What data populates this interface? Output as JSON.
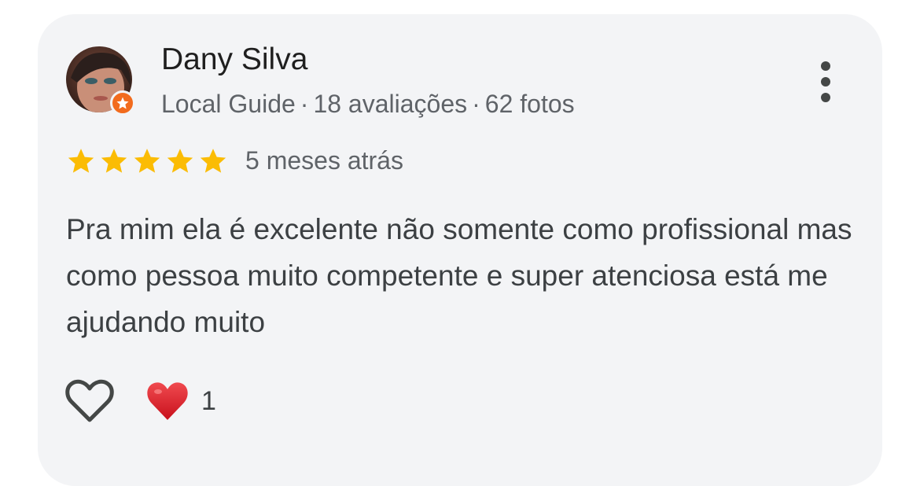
{
  "review": {
    "author_name": "Dany Silva",
    "author_level": "Local Guide",
    "separator": "·",
    "review_count": "18 avaliações",
    "photo_count": "62 fotos",
    "rating": 5,
    "date": "5 meses atrás",
    "text": "Pra mim ela é excelente não somente como profissional mas como pessoa muito competente e super atenciosa está me ajudando muito",
    "reaction_count": "1"
  },
  "icons": {
    "menu": "more-vert-icon",
    "like": "heart-outline-icon",
    "reaction": "red-heart-icon",
    "badge": "local-guide-star-icon"
  },
  "colors": {
    "card_bg": "#f3f4f6",
    "star": "#fbbc04",
    "badge": "#f26b1d",
    "reaction_heart": "#e3202c"
  }
}
